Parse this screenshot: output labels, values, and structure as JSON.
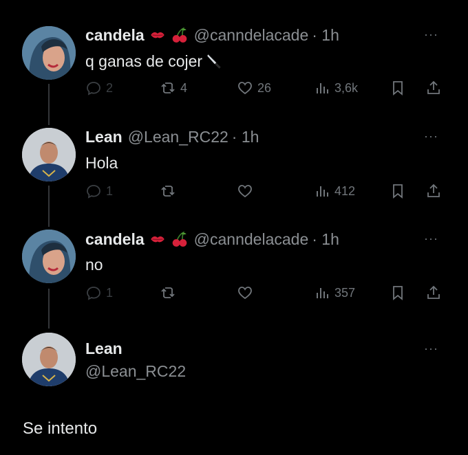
{
  "tweets": [
    {
      "name": "candela",
      "handle": "@canndelacade",
      "time": "· 1h",
      "emojis": [
        "kiss-mark-icon",
        "cherries-icon"
      ],
      "text": "q ganas de cojer",
      "text_emoji": "knife-icon",
      "replies": "2",
      "retweets": "4",
      "likes": "26",
      "views": "3,6k"
    },
    {
      "name": "Lean",
      "handle": "@Lean_RC22",
      "time": "· 1h",
      "text": "Hola",
      "replies": "1",
      "retweets": "",
      "likes": "",
      "views": "412"
    },
    {
      "name": "candela",
      "handle": "@canndelacade",
      "time": "· 1h",
      "emojis": [
        "kiss-mark-icon",
        "cherries-icon"
      ],
      "text": "no",
      "replies": "1",
      "retweets": "",
      "likes": "",
      "views": "357"
    }
  ],
  "composer": {
    "name": "Lean",
    "handle": "@Lean_RC22",
    "text": "Se intento"
  },
  "more_label": "···",
  "colors": {
    "background": "#000000",
    "text": "#e7e9ea",
    "muted": "#71767b",
    "thread_line": "#333639"
  }
}
